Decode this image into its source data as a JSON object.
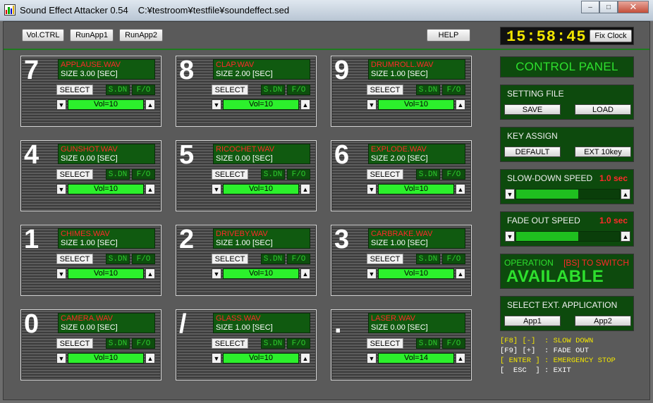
{
  "window": {
    "title": "Sound Effect Attacker 0.54",
    "path": "C:¥testroom¥testfile¥soundeffect.sed",
    "minimize_glyph": "–",
    "maximize_glyph": "□",
    "close_glyph": "✕"
  },
  "toolbar": {
    "volctrl": "Vol.CTRL",
    "runapp1": "RunApp1",
    "runapp2": "RunApp2",
    "help": "HELP"
  },
  "clock": {
    "time": "15:58:45",
    "fix_clock": "Fix Clock"
  },
  "tile_common": {
    "select_label": "SELECT",
    "sdn_label": "S.DN",
    "fo_label": "F/O",
    "down_glyph": "▼",
    "up_glyph": "▲"
  },
  "tiles": [
    {
      "key": "7",
      "file": "APPLAUSE.WAV",
      "size": "SIZE 3.00 [SEC]",
      "volume": "Vol=10",
      "vol_level": 1.0
    },
    {
      "key": "8",
      "file": "CLAP.WAV",
      "size": "SIZE 2.00 [SEC]",
      "volume": "Vol=10",
      "vol_level": 1.0
    },
    {
      "key": "9",
      "file": "DRUMROLL.WAV",
      "size": "SIZE 1.00 [SEC]",
      "volume": "Vol=10",
      "vol_level": 1.0
    },
    {
      "key": "4",
      "file": "GUNSHOT.WAV",
      "size": "SIZE 0.00 [SEC]",
      "volume": "Vol=10",
      "vol_level": 1.0
    },
    {
      "key": "5",
      "file": "RICOCHET.WAV",
      "size": "SIZE 0.00 [SEC]",
      "volume": "Vol=10",
      "vol_level": 1.0
    },
    {
      "key": "6",
      "file": "EXPLODE.WAV",
      "size": "SIZE 2.00 [SEC]",
      "volume": "Vol=10",
      "vol_level": 1.0
    },
    {
      "key": "1",
      "file": "CHIMES.WAV",
      "size": "SIZE 1.00 [SEC]",
      "volume": "Vol=10",
      "vol_level": 1.0
    },
    {
      "key": "2",
      "file": "DRIVEBY.WAV",
      "size": "SIZE 1.00 [SEC]",
      "volume": "Vol=10",
      "vol_level": 1.0
    },
    {
      "key": "3",
      "file": "CARBRAKE.WAV",
      "size": "SIZE 1.00 [SEC]",
      "volume": "Vol=10",
      "vol_level": 1.0
    },
    {
      "key": "0",
      "file": "CAMERA.WAV",
      "size": "SIZE 0.00 [SEC]",
      "volume": "Vol=10",
      "vol_level": 1.0
    },
    {
      "key": "/",
      "file": "GLASS.WAV",
      "size": "SIZE 1.00 [SEC]",
      "volume": "Vol=10",
      "vol_level": 1.0
    },
    {
      "key": ".",
      "file": "LASER.WAV",
      "size": "SIZE 0.00 [SEC]",
      "volume": "Vol=14",
      "vol_level": 1.0
    }
  ],
  "control_panel": {
    "title": "CONTROL PANEL",
    "setting_file": {
      "label": "SETTING FILE",
      "save": "SAVE",
      "load": "LOAD"
    },
    "key_assign": {
      "label": "KEY ASSIGN",
      "default": "DEFAULT",
      "ext": "EXT 10key"
    },
    "slow_down": {
      "label": "SLOW-DOWN SPEED",
      "value": "1.0 sec",
      "level": 0.6
    },
    "fade_out": {
      "label": "FADE OUT SPEED",
      "value": "1.0 sec",
      "level": 0.6
    },
    "operation": {
      "label": "OPERATION",
      "hint": "[BS] TO SWITCH",
      "status": "AVAILABLE"
    },
    "ext_app": {
      "label": "SELECT EXT. APPLICATION",
      "app1": "App1",
      "app2": "App2"
    }
  },
  "key_help": [
    {
      "text": "[F8] [-]  : SLOW DOWN",
      "color": "#f2e600"
    },
    {
      "text": "[F9] [+]  : FADE OUT",
      "color": "#ffffff"
    },
    {
      "text": "[ ENTER ] : EMERGENCY STOP",
      "color": "#f2e600"
    },
    {
      "text": "[  ESC  ] : EXIT",
      "color": "#ffffff"
    }
  ],
  "colors": {
    "panel_green": "#0d4a0d",
    "text_green": "#2ee02e",
    "text_red": "#ff2a2a",
    "clock_yellow": "#f2e600",
    "volume_fill": "#2cf02c"
  }
}
